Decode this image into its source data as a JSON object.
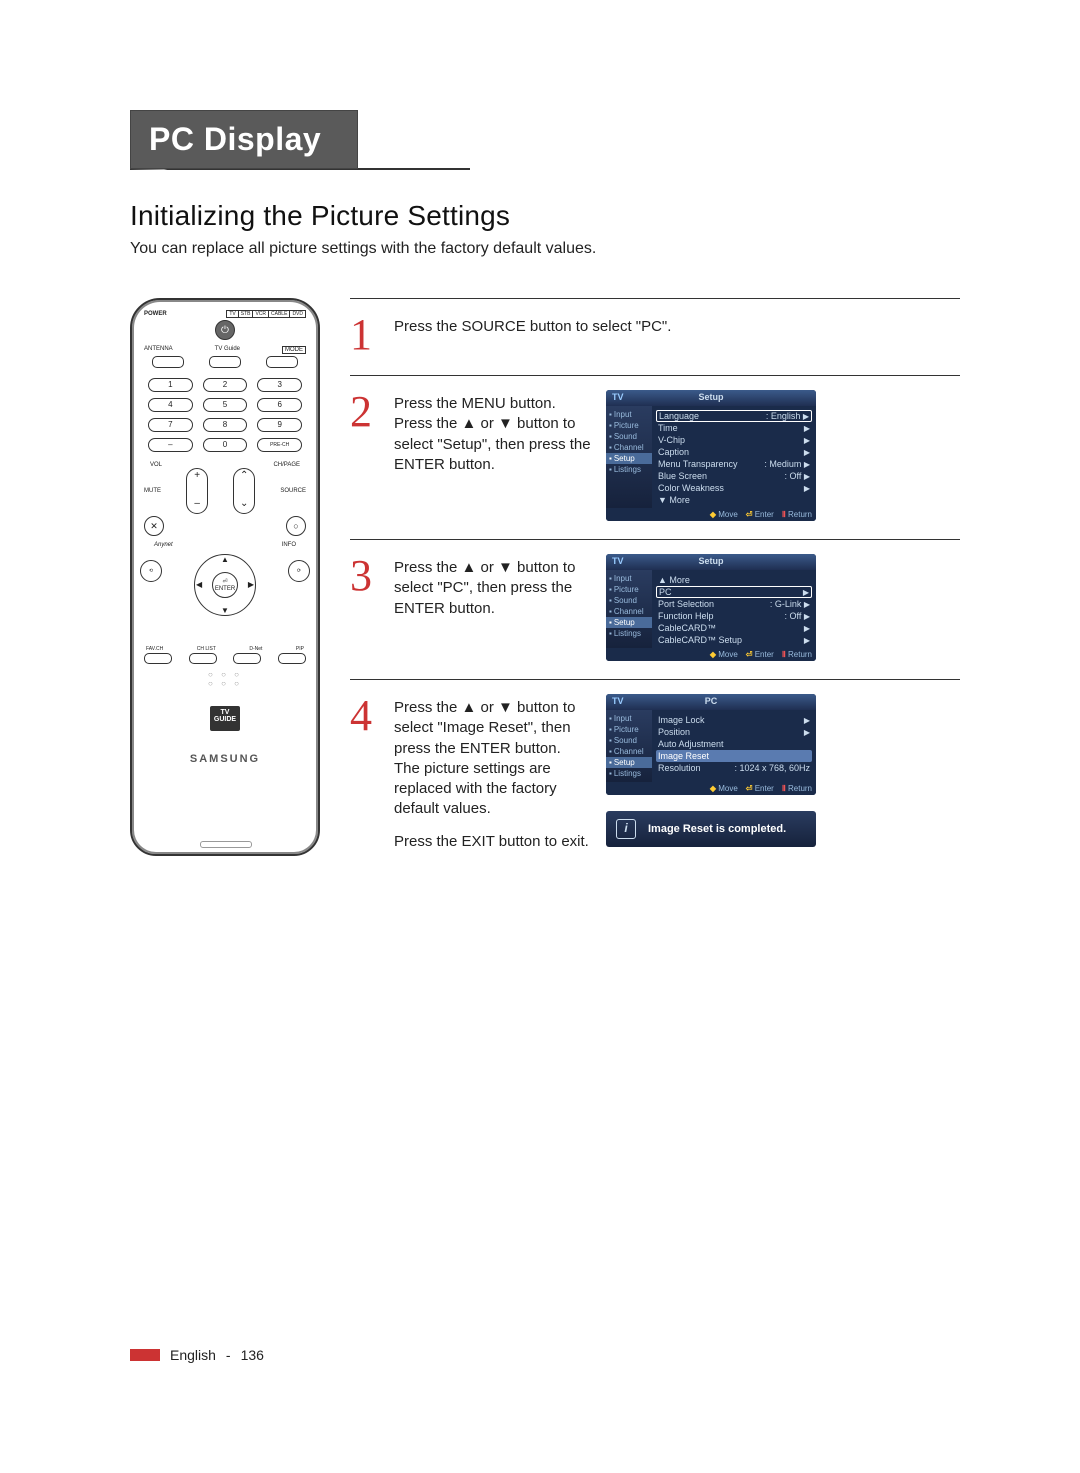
{
  "header": {
    "tab": "PC Display",
    "subhead": "Initializing the Picture Settings",
    "intro": "You can replace all picture settings with the factory default values."
  },
  "remote": {
    "power": "POWER",
    "modes": [
      "TV",
      "STB",
      "VCR",
      "CABLE",
      "DVD"
    ],
    "top": {
      "antenna": "ANTENNA",
      "tvguide": "TV Guide",
      "mode": "MODE"
    },
    "numbers": [
      "1",
      "2",
      "3",
      "4",
      "5",
      "6",
      "7",
      "8",
      "9",
      "–",
      "0",
      "PRE-CH"
    ],
    "vol": "VOL",
    "chpage": "CH/PAGE",
    "mute": "MUTE",
    "source": "SOURCE",
    "anynet": "Anynet",
    "info": "INFO",
    "enter": "ENTER",
    "favch": "FAV.CH",
    "chlist": "CH LIST",
    "dnet": "D-Net",
    "pip": "PIP",
    "tvguide_logo": "TV\nGUIDE",
    "brand": "SAMSUNG"
  },
  "steps": [
    {
      "num": "1",
      "text": "Press the SOURCE button to select \"PC\"."
    },
    {
      "num": "2",
      "text": "Press the MENU button.\nPress the ▲ or ▼ button to select \"Setup\", then press the ENTER button."
    },
    {
      "num": "3",
      "text": "Press the ▲ or ▼ button to select \"PC\", then press the ENTER button."
    },
    {
      "num": "4",
      "text": "Press the ▲ or ▼ button to select \"Image Reset\", then press the ENTER button.\nThe picture settings are replaced with the factory default values.",
      "text2": "Press the EXIT button to exit."
    }
  ],
  "osd_common": {
    "tv": "TV",
    "side": [
      "Input",
      "Picture",
      "Sound",
      "Channel",
      "Setup",
      "Listings"
    ],
    "foot_move": "Move",
    "foot_enter": "Enter",
    "foot_return": "Return"
  },
  "osd2": {
    "title": "Setup",
    "active_side": "Setup",
    "rows": [
      {
        "l": "Language",
        "r": ": English",
        "sel": true
      },
      {
        "l": "Time",
        "r": ""
      },
      {
        "l": "V-Chip",
        "r": ""
      },
      {
        "l": "Caption",
        "r": ""
      },
      {
        "l": "Menu Transparency",
        "r": ": Medium"
      },
      {
        "l": "Blue Screen",
        "r": ": Off"
      },
      {
        "l": "Color Weakness",
        "r": ""
      },
      {
        "l": "▼ More",
        "r": "",
        "nocaret": true
      }
    ]
  },
  "osd3": {
    "title": "Setup",
    "active_side": "Setup",
    "rows": [
      {
        "l": "▲ More",
        "r": "",
        "nocaret": true
      },
      {
        "l": "PC",
        "r": "",
        "sel": true
      },
      {
        "l": "Port Selection",
        "r": ": G-Link"
      },
      {
        "l": "Function Help",
        "r": ": Off"
      },
      {
        "l": "CableCARD™",
        "r": ""
      },
      {
        "l": "CableCARD™ Setup",
        "r": ""
      }
    ]
  },
  "osd4": {
    "title": "PC",
    "active_side": "Setup",
    "rows": [
      {
        "l": "Image Lock",
        "r": ""
      },
      {
        "l": "Position",
        "r": ""
      },
      {
        "l": "Auto Adjustment",
        "r": "",
        "nocaret": true
      },
      {
        "l": "Image Reset",
        "r": "",
        "hl": true,
        "nocaret": true
      },
      {
        "l": "Resolution",
        "r": ": 1024 x 768, 60Hz",
        "nocaret": true
      }
    ]
  },
  "info_bar": "Image Reset is completed.",
  "footer": {
    "lang": "English",
    "page": "136"
  }
}
